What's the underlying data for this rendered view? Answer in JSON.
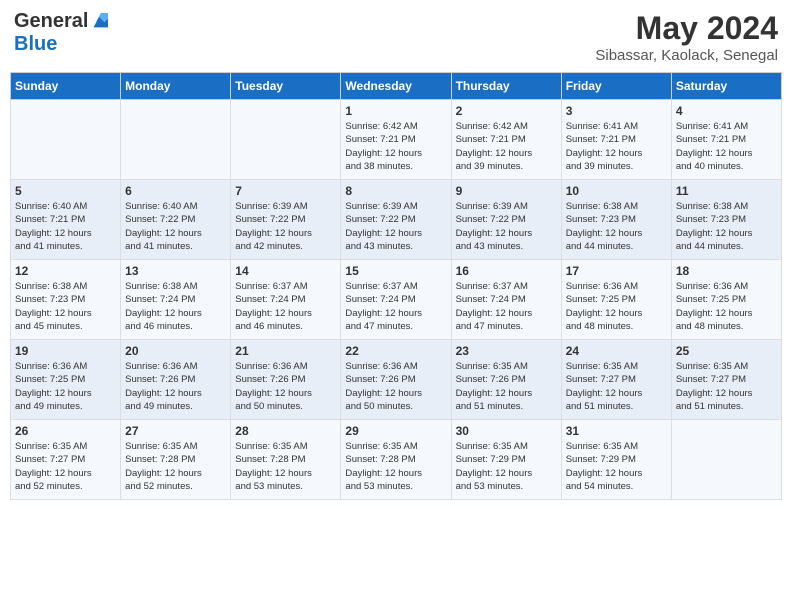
{
  "header": {
    "logo_general": "General",
    "logo_blue": "Blue",
    "month_year": "May 2024",
    "location": "Sibassar, Kaolack, Senegal"
  },
  "days_of_week": [
    "Sunday",
    "Monday",
    "Tuesday",
    "Wednesday",
    "Thursday",
    "Friday",
    "Saturday"
  ],
  "weeks": [
    [
      {
        "day": "",
        "info": ""
      },
      {
        "day": "",
        "info": ""
      },
      {
        "day": "",
        "info": ""
      },
      {
        "day": "1",
        "info": "Sunrise: 6:42 AM\nSunset: 7:21 PM\nDaylight: 12 hours\nand 38 minutes."
      },
      {
        "day": "2",
        "info": "Sunrise: 6:42 AM\nSunset: 7:21 PM\nDaylight: 12 hours\nand 39 minutes."
      },
      {
        "day": "3",
        "info": "Sunrise: 6:41 AM\nSunset: 7:21 PM\nDaylight: 12 hours\nand 39 minutes."
      },
      {
        "day": "4",
        "info": "Sunrise: 6:41 AM\nSunset: 7:21 PM\nDaylight: 12 hours\nand 40 minutes."
      }
    ],
    [
      {
        "day": "5",
        "info": "Sunrise: 6:40 AM\nSunset: 7:21 PM\nDaylight: 12 hours\nand 41 minutes."
      },
      {
        "day": "6",
        "info": "Sunrise: 6:40 AM\nSunset: 7:22 PM\nDaylight: 12 hours\nand 41 minutes."
      },
      {
        "day": "7",
        "info": "Sunrise: 6:39 AM\nSunset: 7:22 PM\nDaylight: 12 hours\nand 42 minutes."
      },
      {
        "day": "8",
        "info": "Sunrise: 6:39 AM\nSunset: 7:22 PM\nDaylight: 12 hours\nand 43 minutes."
      },
      {
        "day": "9",
        "info": "Sunrise: 6:39 AM\nSunset: 7:22 PM\nDaylight: 12 hours\nand 43 minutes."
      },
      {
        "day": "10",
        "info": "Sunrise: 6:38 AM\nSunset: 7:23 PM\nDaylight: 12 hours\nand 44 minutes."
      },
      {
        "day": "11",
        "info": "Sunrise: 6:38 AM\nSunset: 7:23 PM\nDaylight: 12 hours\nand 44 minutes."
      }
    ],
    [
      {
        "day": "12",
        "info": "Sunrise: 6:38 AM\nSunset: 7:23 PM\nDaylight: 12 hours\nand 45 minutes."
      },
      {
        "day": "13",
        "info": "Sunrise: 6:38 AM\nSunset: 7:24 PM\nDaylight: 12 hours\nand 46 minutes."
      },
      {
        "day": "14",
        "info": "Sunrise: 6:37 AM\nSunset: 7:24 PM\nDaylight: 12 hours\nand 46 minutes."
      },
      {
        "day": "15",
        "info": "Sunrise: 6:37 AM\nSunset: 7:24 PM\nDaylight: 12 hours\nand 47 minutes."
      },
      {
        "day": "16",
        "info": "Sunrise: 6:37 AM\nSunset: 7:24 PM\nDaylight: 12 hours\nand 47 minutes."
      },
      {
        "day": "17",
        "info": "Sunrise: 6:36 AM\nSunset: 7:25 PM\nDaylight: 12 hours\nand 48 minutes."
      },
      {
        "day": "18",
        "info": "Sunrise: 6:36 AM\nSunset: 7:25 PM\nDaylight: 12 hours\nand 48 minutes."
      }
    ],
    [
      {
        "day": "19",
        "info": "Sunrise: 6:36 AM\nSunset: 7:25 PM\nDaylight: 12 hours\nand 49 minutes."
      },
      {
        "day": "20",
        "info": "Sunrise: 6:36 AM\nSunset: 7:26 PM\nDaylight: 12 hours\nand 49 minutes."
      },
      {
        "day": "21",
        "info": "Sunrise: 6:36 AM\nSunset: 7:26 PM\nDaylight: 12 hours\nand 50 minutes."
      },
      {
        "day": "22",
        "info": "Sunrise: 6:36 AM\nSunset: 7:26 PM\nDaylight: 12 hours\nand 50 minutes."
      },
      {
        "day": "23",
        "info": "Sunrise: 6:35 AM\nSunset: 7:26 PM\nDaylight: 12 hours\nand 51 minutes."
      },
      {
        "day": "24",
        "info": "Sunrise: 6:35 AM\nSunset: 7:27 PM\nDaylight: 12 hours\nand 51 minutes."
      },
      {
        "day": "25",
        "info": "Sunrise: 6:35 AM\nSunset: 7:27 PM\nDaylight: 12 hours\nand 51 minutes."
      }
    ],
    [
      {
        "day": "26",
        "info": "Sunrise: 6:35 AM\nSunset: 7:27 PM\nDaylight: 12 hours\nand 52 minutes."
      },
      {
        "day": "27",
        "info": "Sunrise: 6:35 AM\nSunset: 7:28 PM\nDaylight: 12 hours\nand 52 minutes."
      },
      {
        "day": "28",
        "info": "Sunrise: 6:35 AM\nSunset: 7:28 PM\nDaylight: 12 hours\nand 53 minutes."
      },
      {
        "day": "29",
        "info": "Sunrise: 6:35 AM\nSunset: 7:28 PM\nDaylight: 12 hours\nand 53 minutes."
      },
      {
        "day": "30",
        "info": "Sunrise: 6:35 AM\nSunset: 7:29 PM\nDaylight: 12 hours\nand 53 minutes."
      },
      {
        "day": "31",
        "info": "Sunrise: 6:35 AM\nSunset: 7:29 PM\nDaylight: 12 hours\nand 54 minutes."
      },
      {
        "day": "",
        "info": ""
      }
    ]
  ]
}
